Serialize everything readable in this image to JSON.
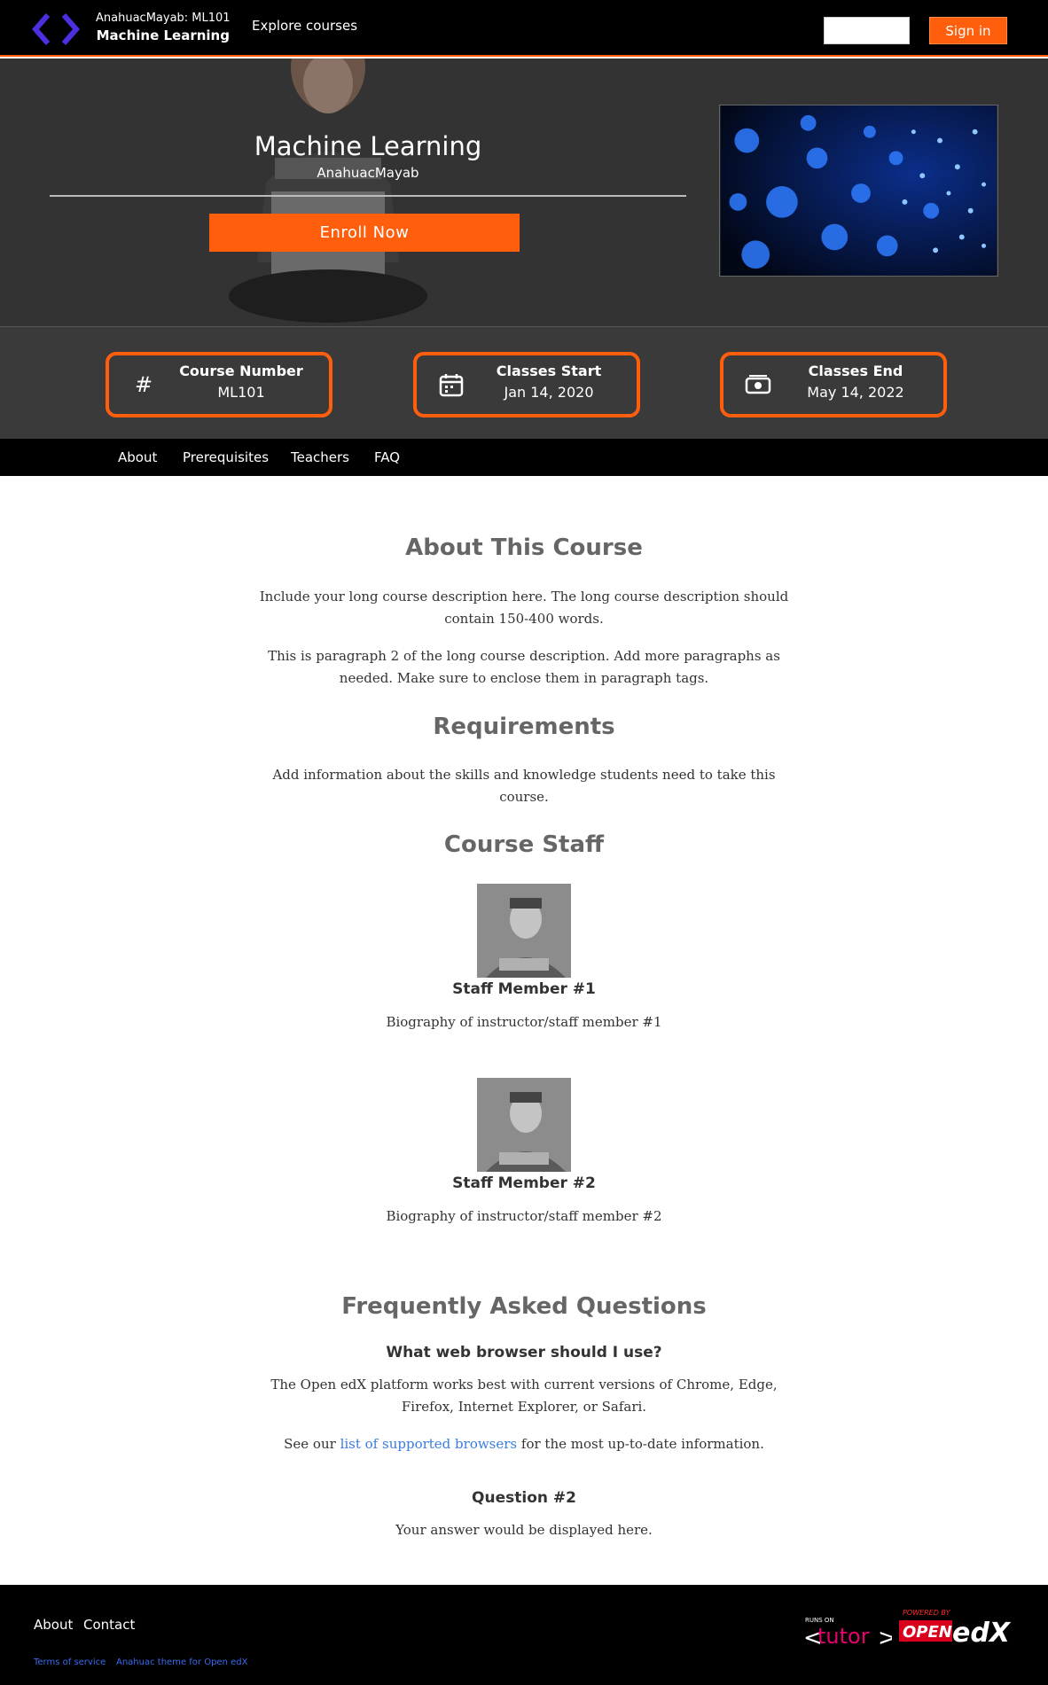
{
  "header": {
    "subtitle": "AnahuacMayab: ML101",
    "title": "Machine Learning",
    "explore_label": "Explore courses",
    "signin_label": "Sign in"
  },
  "hero": {
    "course_title": "Machine Learning",
    "org": "AnahuacMayab",
    "enroll_label": "Enroll Now"
  },
  "info": [
    {
      "icon": "hash-icon",
      "label": "Course Number",
      "value": "ML101"
    },
    {
      "icon": "calendar-icon",
      "label": "Classes Start",
      "value": "Jan 14, 2020"
    },
    {
      "icon": "money-icon",
      "label": "Classes End",
      "value": "May 14, 2022"
    }
  ],
  "tabs": [
    "About",
    "Prerequisites",
    "Teachers",
    "FAQ"
  ],
  "about": {
    "heading": "About This Course",
    "p1": "Include your long course description here. The long course description should contain 150-400 words.",
    "p2": "This is paragraph 2 of the long course description. Add more paragraphs as needed. Make sure to enclose them in paragraph tags."
  },
  "requirements": {
    "heading": "Requirements",
    "p1": "Add information about the skills and knowledge students need to take this course."
  },
  "staff": {
    "heading": "Course Staff",
    "members": [
      {
        "name": "Staff Member #1",
        "bio": "Biography of instructor/staff member #1"
      },
      {
        "name": "Staff Member #2",
        "bio": "Biography of instructor/staff member #2"
      }
    ]
  },
  "faq": {
    "heading": "Frequently Asked Questions",
    "q1": "What web browser should I use?",
    "a1": "The Open edX platform works best with current versions of Chrome, Edge, Firefox, Internet Explorer, or Safari.",
    "a1b_pre": "See our ",
    "a1b_link": "list of supported browsers",
    "a1b_post": " for the most up-to-date information.",
    "q2": "Question #2",
    "a2": "Your answer would be displayed here."
  },
  "footer": {
    "about": "About",
    "contact": "Contact",
    "terms": "Terms of service",
    "theme": "Anahuac theme for Open edX",
    "tutor_runs_on": "RUNS ON",
    "tutor": "tutor",
    "edx_powered": "POWERED BY",
    "edx_open": "OPEN",
    "edx_edx": "edX"
  },
  "colors": {
    "accent": "#ff5f0d",
    "logo": "#4b2fe0",
    "link": "#3a7be0"
  }
}
